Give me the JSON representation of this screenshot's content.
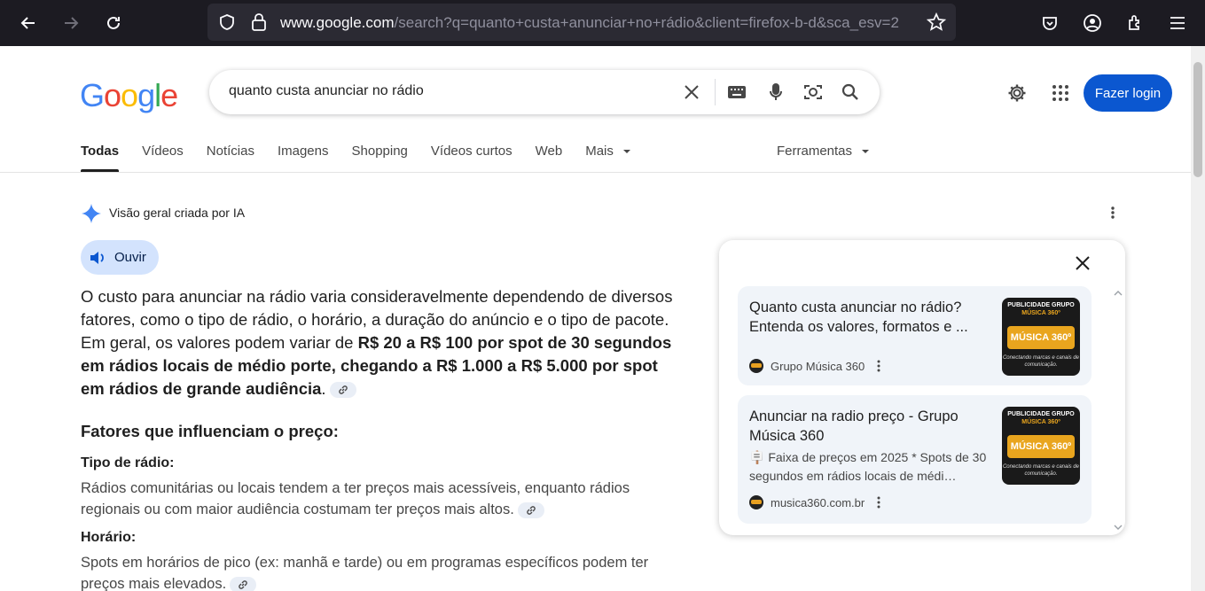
{
  "browser": {
    "url_host": "www.google.com",
    "url_path": "/search?q=quanto+custa+anunciar+no+rádio&client=firefox-b-d&sca_esv=2"
  },
  "logo": {
    "text": "Google"
  },
  "search": {
    "query": "quanto custa anunciar no rádio"
  },
  "header": {
    "login_label": "Fazer login"
  },
  "tabs": [
    {
      "label": "Todas"
    },
    {
      "label": "Vídeos"
    },
    {
      "label": "Notícias"
    },
    {
      "label": "Imagens"
    },
    {
      "label": "Shopping"
    },
    {
      "label": "Vídeos curtos"
    },
    {
      "label": "Web"
    },
    {
      "label": "Mais"
    }
  ],
  "tools_label": "Ferramentas",
  "ai_overview": {
    "heading": "Visão geral criada por IA",
    "listen_label": "Ouvir",
    "para_part1": "O custo para anunciar na rádio varia consideravelmente dependendo de diversos fatores, como o tipo de rádio, o horário, a duração do anúncio e o tipo de pacote. Em geral, os valores podem variar de ",
    "para_bold": "R$ 20 a R$ 100 por spot de 30 segundos em rádios locais de médio porte, chegando a R$ 1.000 a R$ 5.000 por spot em rádios de grande audiência",
    "para_end": ".",
    "factors_heading": "Fatores que influenciam o preço:",
    "factors": [
      {
        "title": "Tipo de rádio:",
        "text": "Rádios comunitárias ou locais tendem a ter preços mais acessíveis, enquanto rádios regionais ou com maior audiência costumam ter preços mais altos."
      },
      {
        "title": "Horário:",
        "text": "Spots em horários de pico (ex: manhã e tarde) ou em programas específicos podem ter preços mais elevados."
      }
    ]
  },
  "sources": [
    {
      "title": "Quanto custa anunciar no rádio? Entenda os valores, formatos e ...",
      "snippet": "",
      "source": "Grupo Música 360",
      "thumb_top1": "PUBLICIDADE GRUPO",
      "thumb_top2": "MÚSICA 360º",
      "thumb_mid": "MÚSICA 360º",
      "thumb_bot": "Conectando marcas e canais de comunicação."
    },
    {
      "title": "Anunciar na radio preço - Grupo Música 360",
      "snippet": "🪧 Faixa de preços em 2025 * Spots de 30 segundos em rádios locais de médi…",
      "source": "musica360.com.br",
      "thumb_top1": "PUBLICIDADE GRUPO",
      "thumb_top2": "MÚSICA 360º",
      "thumb_mid": "MÚSICA 360º",
      "thumb_bot": "Conectando marcas e canais de comunicação."
    }
  ],
  "colors": {
    "primary": "#0b57d0",
    "chip_bg": "#d3e3fd",
    "card_bg": "#f0f4f9"
  }
}
